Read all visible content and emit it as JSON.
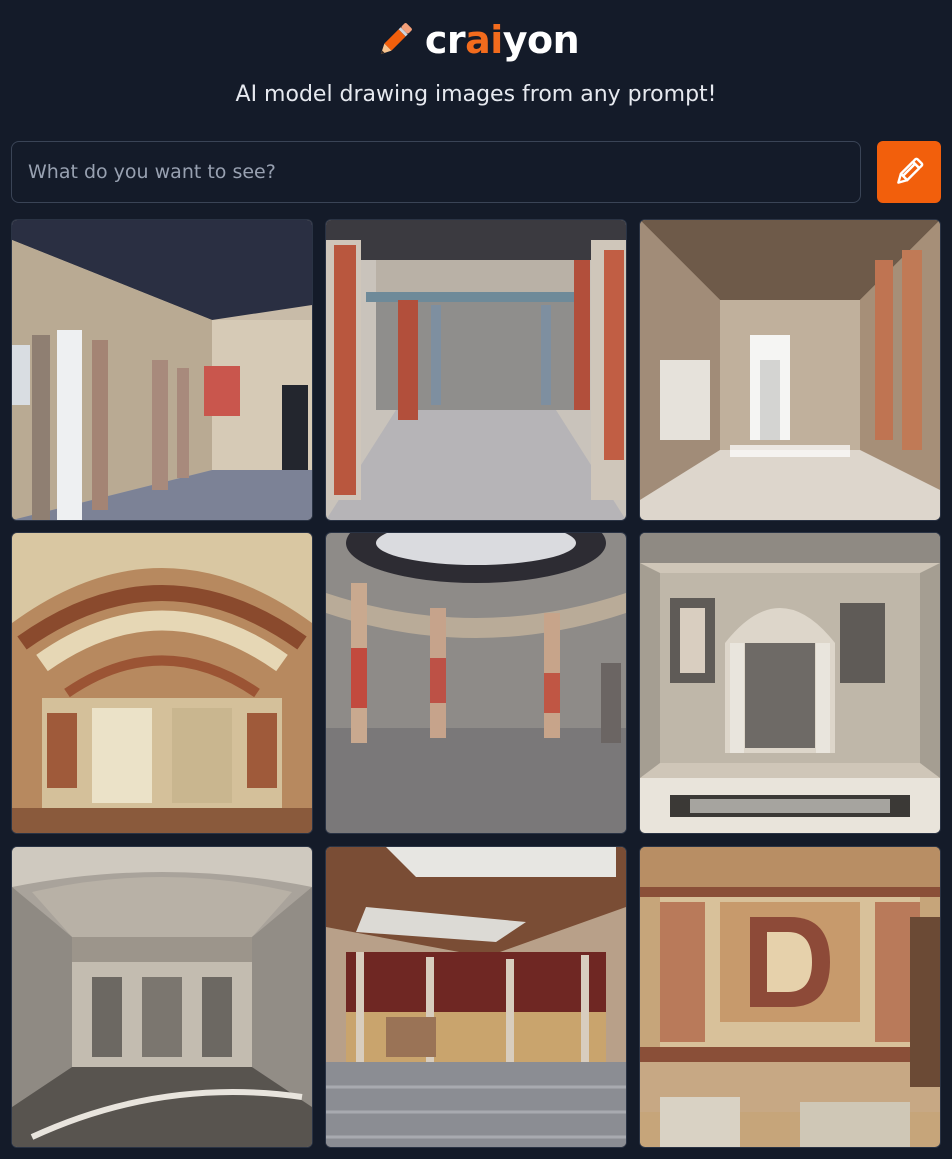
{
  "app": {
    "logo": {
      "prefix": "cr",
      "accent": "ai",
      "suffix": "yon",
      "icon": "pencil-icon"
    },
    "tagline": "AI model drawing images from any prompt!"
  },
  "search": {
    "placeholder": "What do you want to see?",
    "value": "",
    "button_icon": "pencil-icon"
  },
  "colors": {
    "background": "#141b29",
    "accent": "#f25f0c",
    "border": "#3a4456"
  },
  "results": {
    "count": 9,
    "columns": 3
  }
}
